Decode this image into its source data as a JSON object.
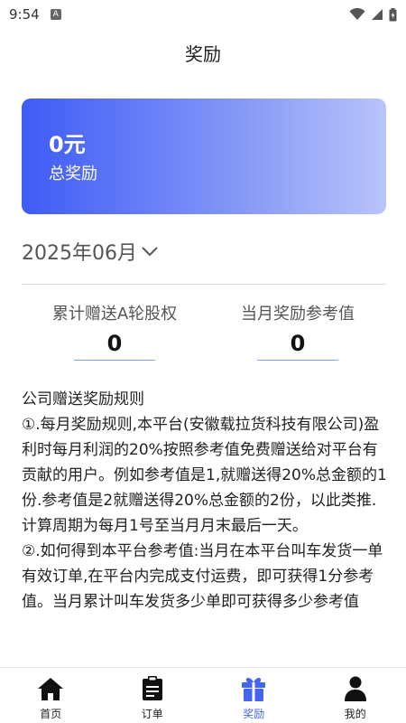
{
  "status_bar": {
    "time": "9:54",
    "badge": "A"
  },
  "header": {
    "title": "奖励"
  },
  "summary": {
    "amount": "0元",
    "label": "总奖励"
  },
  "month_filter": {
    "value": "2025年06月"
  },
  "stats": [
    {
      "label": "累计赠送A轮股权",
      "value": "0"
    },
    {
      "label": "当月奖励参考值",
      "value": "0"
    }
  ],
  "rules": {
    "title": "公司赠送奖励规则",
    "paragraphs": [
      "①.每月奖励规则,本平台(安徽载拉货科技有限公司)盈利时每月利润的20%按照参考值免费赠送给对平台有贡献的用户。例如参考值是1,就赠送得20%总金额的1份.参考值是2就赠送得20%总金额的2份，以此类推.计算周期为每月1号至当月月末最后一天。",
      "②.如何得到本平台参考值:当月在本平台叫车发货一单有效订单,在平台内完成支付运费，即可获得1分参考值。当月累计叫车发货多少单即可获得多少参考值"
    ]
  },
  "bottom_nav": [
    {
      "label": "首页",
      "icon": "home-icon",
      "active": false
    },
    {
      "label": "订单",
      "icon": "clipboard-icon",
      "active": false
    },
    {
      "label": "奖励",
      "icon": "gift-icon",
      "active": true
    },
    {
      "label": "我的",
      "icon": "user-icon",
      "active": false
    }
  ],
  "colors": {
    "accent": "#4466ee",
    "card_start": "#3e5bf6",
    "card_end": "#b9c3fb"
  }
}
